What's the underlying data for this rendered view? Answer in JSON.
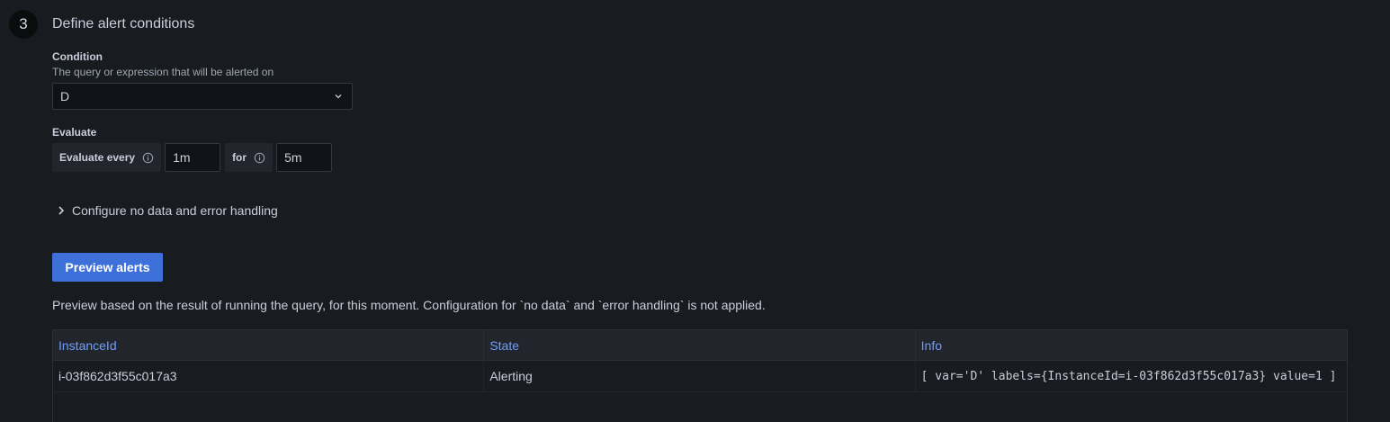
{
  "section": {
    "step_number": "3",
    "title": "Define alert conditions"
  },
  "condition": {
    "label": "Condition",
    "description": "The query or expression that will be alerted on",
    "selected_value": "D"
  },
  "evaluate": {
    "label": "Evaluate",
    "every_label": "Evaluate every",
    "every_value": "1m",
    "for_label": "for",
    "for_value": "5m"
  },
  "no_data_handling": {
    "label": "Configure no data and error handling"
  },
  "preview": {
    "button_label": "Preview alerts",
    "note": "Preview based on the result of running the query, for this moment. Configuration for `no data` and `error handling` is not applied."
  },
  "table": {
    "columns": [
      "InstanceId",
      "State",
      "Info"
    ],
    "rows": [
      {
        "instance_id": "i-03f862d3f55c017a3",
        "state": "Alerting",
        "info": "[ var='D' labels={InstanceId=i-03f862d3f55c017a3} value=1 ]"
      }
    ]
  },
  "colors": {
    "background": "#181b1f",
    "primary_button": "#3d71d9",
    "table_header_text": "#6e9fff"
  }
}
